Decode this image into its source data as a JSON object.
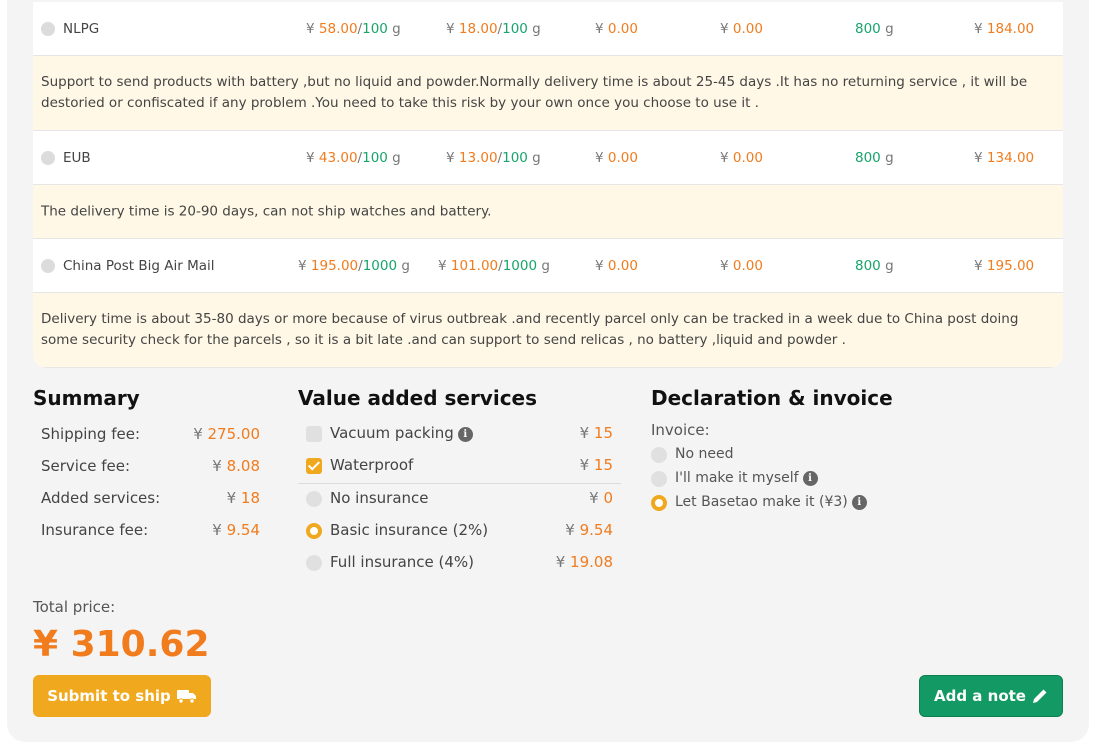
{
  "shipping_rows": [
    {
      "name": "NLPG",
      "first_price": "58.00",
      "first_weight": "100",
      "cont_price": "18.00",
      "cont_weight": "100",
      "fee1": "0.00",
      "fee2": "0.00",
      "min_weight": "800",
      "total": "184.00",
      "note": "Support to send products with battery ,but no liquid and powder.Normally delivery time is about 25-45 days .It has no returning service , it will be destoried or confiscated if any problem .You need to take this risk by your own once you choose to use it ."
    },
    {
      "name": "EUB",
      "first_price": "43.00",
      "first_weight": "100",
      "cont_price": "13.00",
      "cont_weight": "100",
      "fee1": "0.00",
      "fee2": "0.00",
      "min_weight": "800",
      "total": "134.00",
      "note": "The delivery time is 20-90 days, can not ship watches and battery."
    },
    {
      "name": "China Post Big Air Mail",
      "first_price": "195.00",
      "first_weight": "1000",
      "cont_price": "101.00",
      "cont_weight": "1000",
      "fee1": "0.00",
      "fee2": "0.00",
      "min_weight": "800",
      "total": "195.00",
      "note": "Delivery time is about 35-80 days or more because of virus outbreak .and recently parcel only can be tracked in a week due to China post doing some security check for the parcels , so it is a bit late .and can support to send relicas , no battery ,liquid and powder ."
    }
  ],
  "currency": "¥",
  "unit": "g",
  "summary": {
    "title": "Summary",
    "items": [
      {
        "label": "Shipping fee:",
        "value": "275.00"
      },
      {
        "label": "Service fee:",
        "value": "8.08"
      },
      {
        "label": "Added services:",
        "value": "18"
      },
      {
        "label": "Insurance fee:",
        "value": "9.54"
      }
    ]
  },
  "vas": {
    "title": "Value added services",
    "items": [
      {
        "label": "Vacuum packing",
        "price": "15",
        "kind": "checkbox",
        "checked": false,
        "info": true
      },
      {
        "label": "Waterproof",
        "price": "15",
        "kind": "checkbox",
        "checked": true,
        "info": false
      },
      {
        "label": "No insurance",
        "price": "0",
        "kind": "radio",
        "checked": false,
        "info": false
      },
      {
        "label": "Basic insurance (2%)",
        "price": "9.54",
        "kind": "radio",
        "checked": true,
        "info": false
      },
      {
        "label": "Full insurance (4%)",
        "price": "19.08",
        "kind": "radio",
        "checked": false,
        "info": false
      }
    ]
  },
  "declaration": {
    "title": "Declaration & invoice",
    "invoice_label": "Invoice:",
    "options": [
      {
        "label": "No need",
        "checked": false,
        "info": false
      },
      {
        "label": "I'll make it myself",
        "checked": false,
        "info": true
      },
      {
        "label": "Let Basetao make it (¥3)",
        "checked": true,
        "info": true
      }
    ]
  },
  "total": {
    "label": "Total price:",
    "value": "¥ 310.62"
  },
  "buttons": {
    "submit": "Submit to ship",
    "note": "Add a note"
  },
  "icons": {
    "truck": "truck-icon",
    "pencil": "pencil-icon",
    "info": "info-icon"
  },
  "colors": {
    "accent_orange": "#f07c1e",
    "button_yellow": "#f0a81e",
    "green": "#139a64",
    "note_bg": "#fff8e6"
  }
}
